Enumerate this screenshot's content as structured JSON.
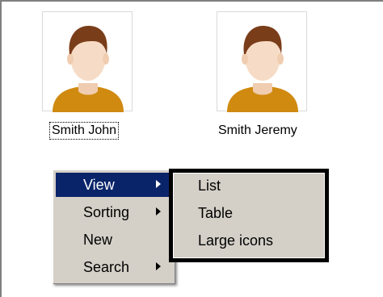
{
  "contacts": [
    {
      "name": "Smith John",
      "selected": true
    },
    {
      "name": "Smith Jeremy",
      "selected": false
    }
  ],
  "context_menu": {
    "items": [
      {
        "label": "View",
        "has_submenu": true,
        "highlighted": true
      },
      {
        "label": "Sorting",
        "has_submenu": true,
        "highlighted": false
      },
      {
        "label": "New",
        "has_submenu": false,
        "highlighted": false
      },
      {
        "label": "Search",
        "has_submenu": true,
        "highlighted": false
      }
    ]
  },
  "view_submenu": {
    "items": [
      {
        "label": "List"
      },
      {
        "label": "Table"
      },
      {
        "label": "Large icons"
      }
    ]
  },
  "colors": {
    "menu_highlight": "#0a246a",
    "menu_background": "#d4d0c8",
    "avatar_shirt": "#d08a10",
    "avatar_hair": "#7a3d1a",
    "avatar_skin": "#f6dcc6"
  }
}
